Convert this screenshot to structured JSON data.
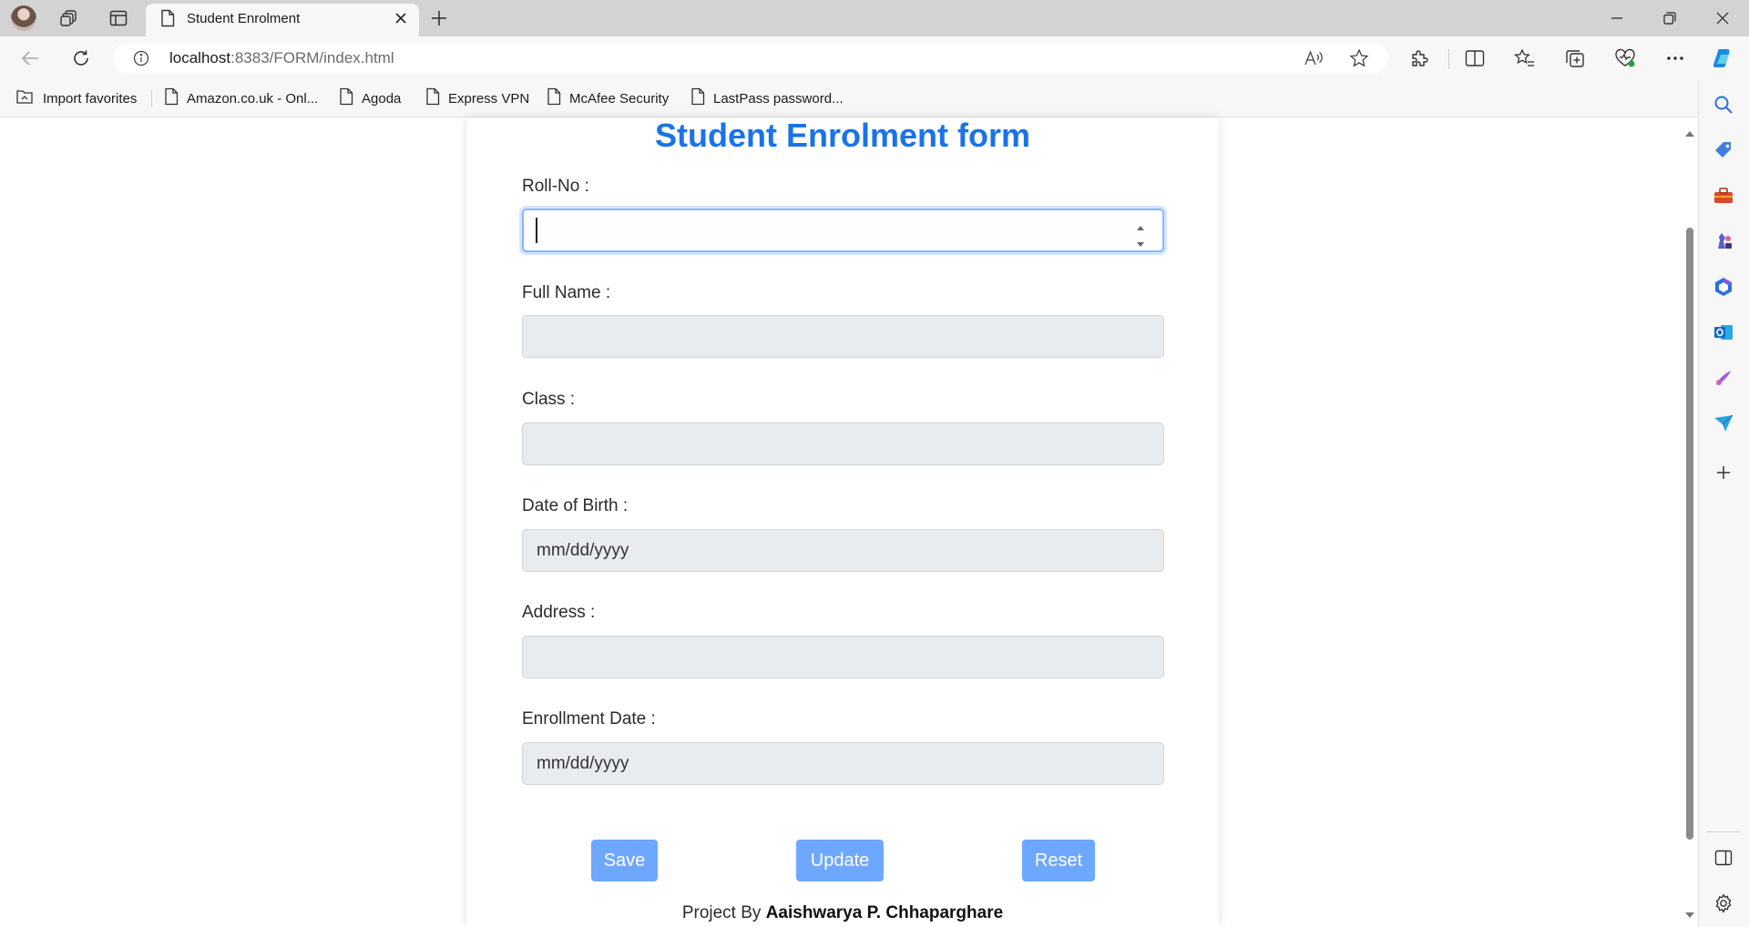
{
  "browser": {
    "tab_title": "Student Enrolment",
    "url_host": "localhost",
    "url_rest": ":8383/FORM/index.html",
    "favorites": [
      {
        "label": "Import favorites"
      },
      {
        "label": "Amazon.co.uk - Onl..."
      },
      {
        "label": "Agoda"
      },
      {
        "label": "Express VPN"
      },
      {
        "label": "McAfee Security"
      },
      {
        "label": "LastPass password..."
      }
    ]
  },
  "form": {
    "title": "Student Enrolment form",
    "fields": {
      "rollno_label": "Roll-No :",
      "rollno_value": "",
      "fullname_label": "Full Name :",
      "fullname_value": "",
      "class_label": "Class :",
      "class_value": "",
      "dob_label": "Date of Birth :",
      "dob_value": "mm/dd/yyyy",
      "address_label": "Address :",
      "address_value": "",
      "enrollment_label": "Enrollment Date :",
      "enrollment_value": "mm/dd/yyyy"
    },
    "buttons": {
      "save": "Save",
      "update": "Update",
      "reset": "Reset"
    },
    "footer_prefix": "Project By",
    "footer_author": "Aaishwarya P. Chhaparghare"
  },
  "colors": {
    "title": "#1a73e8",
    "button": "#6ea8fe",
    "field_bg": "#e9ecef",
    "focus_border": "#86b7fe"
  },
  "icons": {
    "titlebar": [
      "profile-avatar",
      "workspaces-icon",
      "tab-actions-icon",
      "document-icon",
      "close-icon",
      "plus-icon"
    ],
    "navbar": [
      "back-arrow-icon",
      "refresh-icon",
      "info-icon",
      "read-aloud-icon",
      "favorite-star-icon",
      "extensions-icon",
      "split-screen-icon",
      "favorites-icon",
      "collections-icon",
      "browser-essentials-icon",
      "more-icon",
      "copilot-icon"
    ],
    "sidebar": [
      "search-icon",
      "shopping-tag-icon",
      "toolbox-icon",
      "games-icon",
      "microsoft365-icon",
      "outlook-icon",
      "designer-icon",
      "send-icon",
      "add-icon",
      "sidebar-panel-icon",
      "settings-gear-icon"
    ]
  }
}
